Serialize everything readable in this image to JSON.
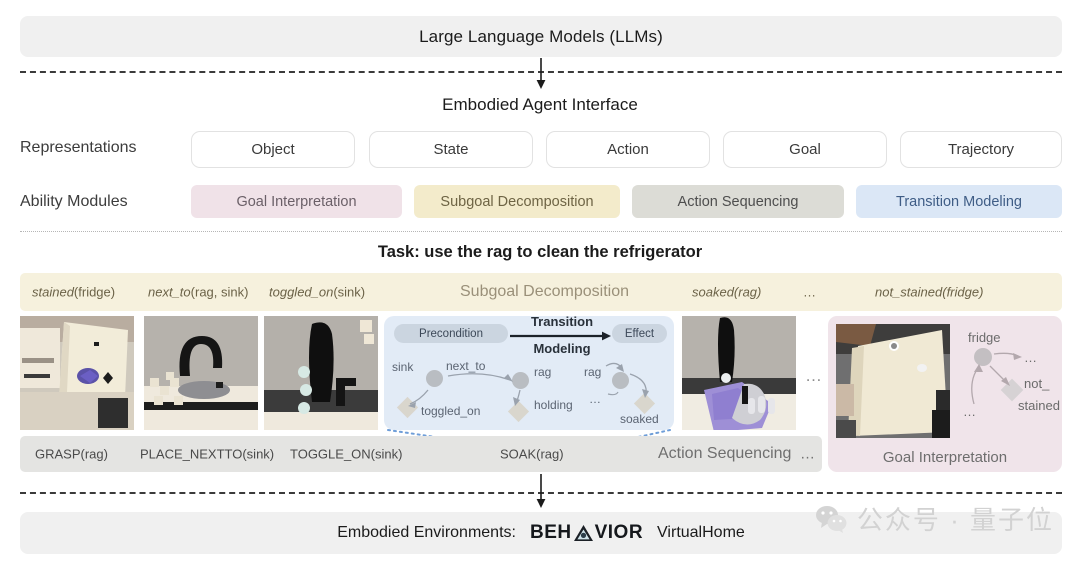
{
  "top": {
    "llm_banner": "Large Language Models (LLMs)"
  },
  "interface": {
    "title": "Embodied Agent Interface"
  },
  "representations": {
    "label": "Representations",
    "items": [
      {
        "label": "Object"
      },
      {
        "label": "State"
      },
      {
        "label": "Action"
      },
      {
        "label": "Goal"
      },
      {
        "label": "Trajectory"
      }
    ]
  },
  "ability_modules": {
    "label": "Ability Modules",
    "items": [
      {
        "label": "Goal Interpretation",
        "bg": "#f0e2e8",
        "fg": "#6b6068"
      },
      {
        "label": "Subgoal Decomposition",
        "bg": "#f3ebcb",
        "fg": "#6e6444"
      },
      {
        "label": "Action Sequencing",
        "bg": "#dcdcd6",
        "fg": "#4e4e4e"
      },
      {
        "label": "Transition Modeling",
        "bg": "#dbe7f6",
        "fg": "#3f5d86"
      }
    ]
  },
  "task": {
    "title": "Task: use the rag to clean the refrigerator",
    "subgoal_row": {
      "module_name": "Subgoal Decomposition",
      "items": [
        {
          "pred": "stained",
          "args": "(fridge)"
        },
        {
          "pred": "next_to",
          "args": "(rag, sink)"
        },
        {
          "pred": "toggled_on",
          "args": "(sink)"
        },
        {
          "pred": "soaked",
          "args": "(rag)"
        },
        {
          "pred": "…",
          "args": ""
        },
        {
          "pred": "not_stained",
          "args": "(fridge)"
        }
      ]
    },
    "action_row": {
      "module_name": "Action Sequencing",
      "trailing_ellipsis": "…",
      "items": [
        {
          "label": "GRASP(rag)"
        },
        {
          "label": "PLACE_NEXTTO(sink)"
        },
        {
          "label": "TOGGLE_ON(sink)"
        },
        {
          "label": "SOAK(rag)"
        }
      ]
    },
    "frames_ellipsis": "…"
  },
  "transition_modeling": {
    "precondition_label": "Precondition",
    "effect_label": "Effect",
    "arrow_label_line1": "Transition",
    "arrow_label_line2": "Modeling",
    "precondition_nodes": [
      "sink",
      "next_to",
      "toggled_on",
      "rag",
      "holding"
    ],
    "effect_nodes": [
      "rag",
      "…",
      "soaked"
    ]
  },
  "goal_interpretation": {
    "label": "Goal Interpretation",
    "nodes": [
      "fridge",
      "…",
      "not_",
      "stained",
      "…"
    ]
  },
  "bottom": {
    "env_label": "Embodied Environments:",
    "behavior": {
      "pre": "BEH",
      "post": "VIOR"
    },
    "virtualhome": "VirtualHome"
  },
  "watermark": {
    "text": "公众号 · 量子位"
  }
}
